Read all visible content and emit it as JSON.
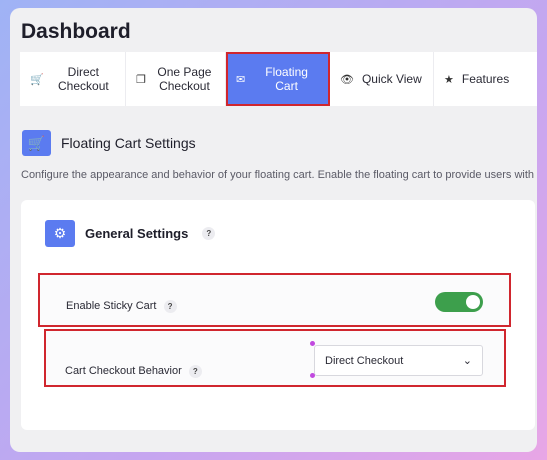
{
  "page_title": "Dashboard",
  "tabs": [
    {
      "label": "Direct Checkout",
      "icon": "cart-icon",
      "active": false
    },
    {
      "label": "One Page Checkout",
      "icon": "copy-icon",
      "active": false
    },
    {
      "label": "Floating Cart",
      "icon": "floating-cart-icon",
      "active": true
    },
    {
      "label": "Quick View",
      "icon": "eye-icon",
      "active": false
    },
    {
      "label": "Features",
      "icon": "star-icon",
      "active": false
    }
  ],
  "section": {
    "title": "Floating Cart Settings",
    "icon": "cart-icon",
    "description": "Configure the appearance and behavior of your floating cart. Enable the floating cart to provide users with quick a"
  },
  "general": {
    "title": "General Settings",
    "icon": "gear-icon",
    "help": "?"
  },
  "settings": {
    "sticky_cart": {
      "label": "Enable Sticky Cart",
      "help": "?",
      "enabled": true
    },
    "checkout_behavior": {
      "label": "Cart Checkout Behavior",
      "help": "?",
      "value": "Direct Checkout"
    }
  },
  "colors": {
    "accent": "#5b7bf0",
    "toggle_on": "#3d9f4c",
    "highlight": "#d0262e"
  }
}
